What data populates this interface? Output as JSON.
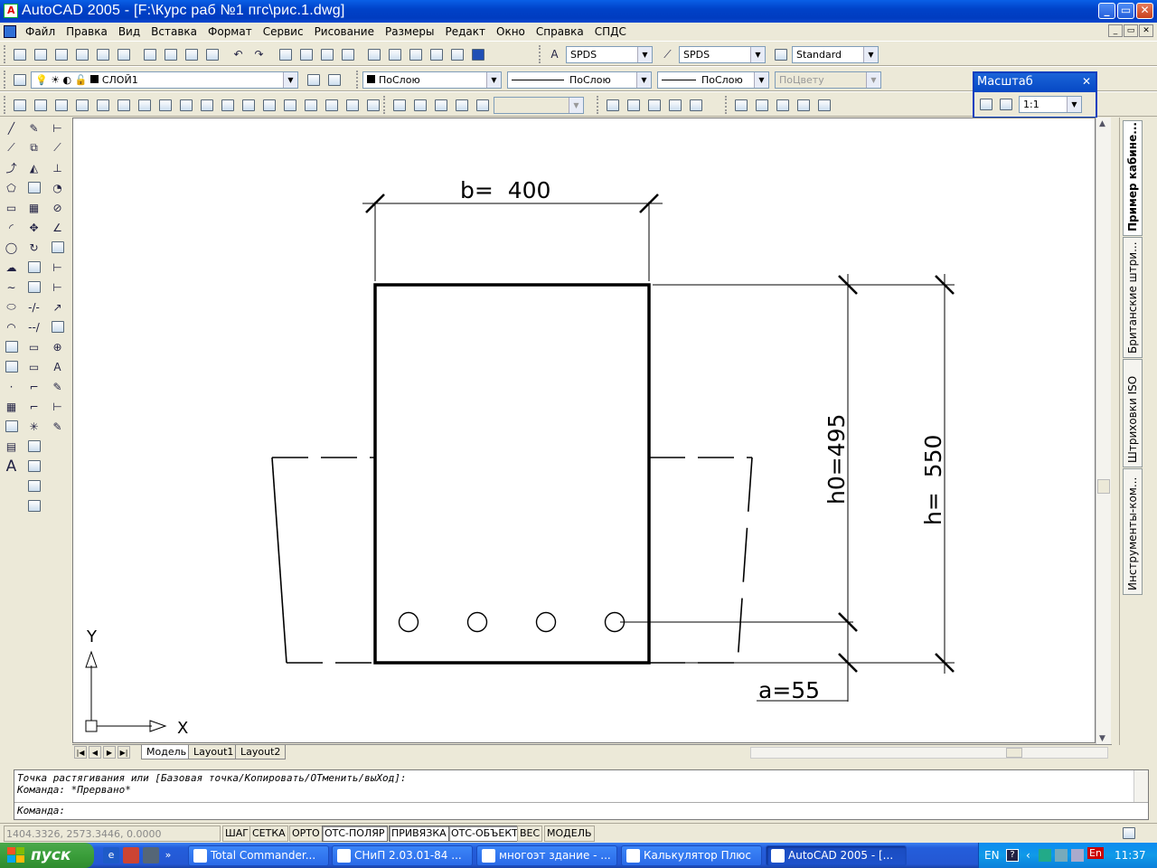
{
  "window": {
    "title": "AutoCAD 2005 - [F:\\Курс раб №1 пгс\\рис.1.dwg]",
    "controls": [
      "_",
      "▭",
      "✕"
    ]
  },
  "menu": [
    "Файл",
    "Правка",
    "Вид",
    "Вставка",
    "Формат",
    "Сервис",
    "Рисование",
    "Размеры",
    "Редакт",
    "Окно",
    "Справка",
    "СПДС"
  ],
  "toolbar": {
    "text_style": "SPDS",
    "dim_style": "SPDS",
    "table_style": "Standard",
    "layer": "СЛОЙ1",
    "color": "ПоСлою",
    "linetype": "ПоСлою",
    "lineweight": "ПоСлою",
    "plotstyle": "ПоЦвету"
  },
  "scale_palette": {
    "title": "Масштаб",
    "value": "1:1"
  },
  "drawing": {
    "b_label": "b=  400",
    "h0_label": "h0=495",
    "h_label": "h=  550",
    "a_label": "a=55",
    "ucs_x": "X",
    "ucs_y": "Y"
  },
  "tool_palette_tabs": [
    "Пример кабине...",
    "Британские штри...",
    "Штриховки ISO",
    "Инструменты-ком..."
  ],
  "layout_tabs": [
    "Модель",
    "Layout1",
    "Layout2"
  ],
  "command": {
    "line1": "Точка растягивания или [Базовая точка/Копировать/ОТменить/выХод]:",
    "line2": "Команда: *Прервано*",
    "prompt": "Команда:"
  },
  "status": {
    "coords": "1404.3326, 2573.3446, 0.0000",
    "buttons": [
      "ШАГ",
      "СЕТКА",
      "ОРТО",
      "ОТС-ПОЛЯР",
      "ПРИВЯЗКА",
      "ОТС-ОБЪЕКТ",
      "ВЕС",
      "МОДЕЛЬ"
    ]
  },
  "taskbar": {
    "start": "пуск",
    "tasks": [
      "Total Commander...",
      "СНиП 2.03.01-84 ...",
      "многоэт здание - ...",
      "Калькулятор Плюс",
      "AutoCAD 2005 - [..."
    ],
    "lang": "EN",
    "lang2": "En",
    "clock": "11:37"
  },
  "colors": {
    "title_bar": "#0042c8",
    "chrome": "#ece9d8",
    "taskbar": "#245edb",
    "start": "#3a9e3a",
    "drawing_bg": "#ffffff"
  }
}
